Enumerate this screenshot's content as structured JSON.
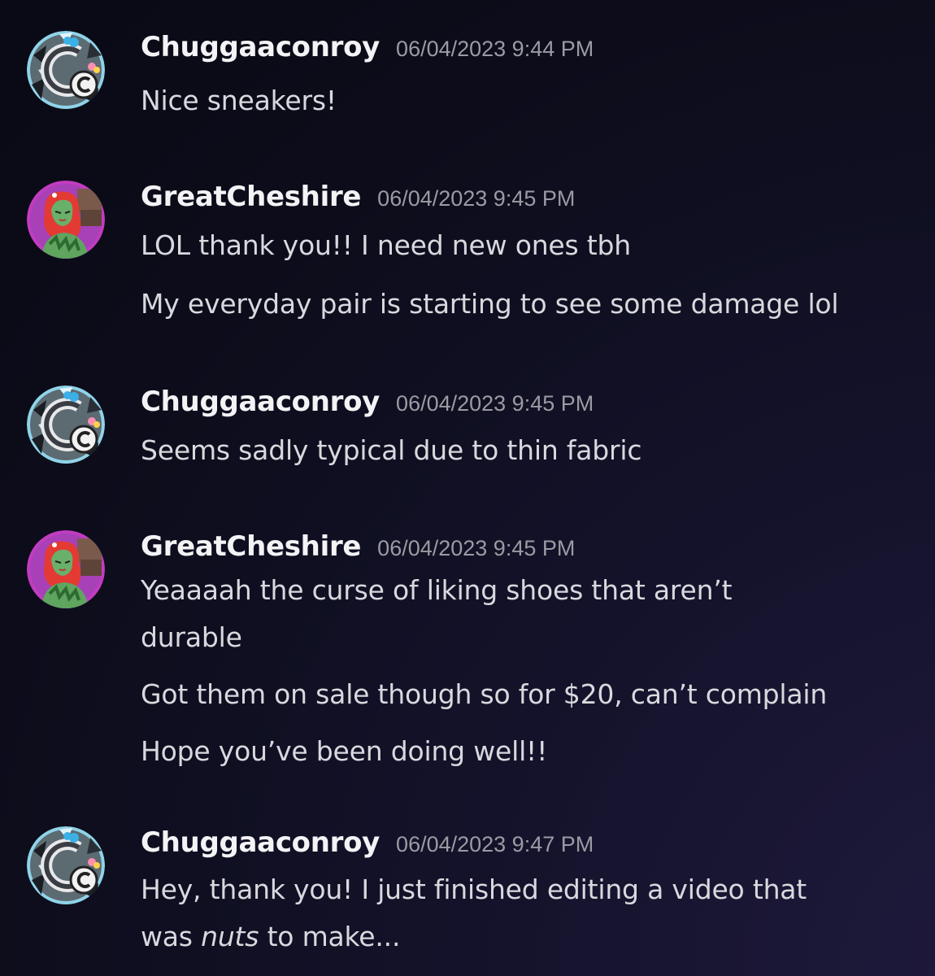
{
  "messages": [
    {
      "author": "Chuggaaconroy",
      "timestamp": "06/04/2023 9:44 PM",
      "avatar": "chuggaaconroy-avatar",
      "lines": [
        "Nice sneakers!"
      ]
    },
    {
      "author": "GreatCheshire",
      "timestamp": "06/04/2023 9:45 PM",
      "avatar": "greatcheshire-avatar",
      "lines": [
        "LOL thank you!! I need new ones tbh",
        "My everyday pair is starting to see some damage lol"
      ]
    },
    {
      "author": "Chuggaaconroy",
      "timestamp": "06/04/2023 9:45 PM",
      "avatar": "chuggaaconroy-avatar",
      "lines": [
        "Seems sadly typical due to thin fabric"
      ]
    },
    {
      "author": "GreatCheshire",
      "timestamp": "06/04/2023 9:45 PM",
      "avatar": "greatcheshire-avatar",
      "lines": [
        "Yeaaaah the curse of liking shoes that aren’t",
        "durable",
        "Got them on sale though so for $20, can’t complain",
        "Hope you’ve been doing well!!"
      ]
    },
    {
      "author": "Chuggaaconroy",
      "timestamp": "06/04/2023 9:47 PM",
      "avatar": "chuggaaconroy-avatar",
      "lines": [
        "Hey, thank you! I just finished editing a video that"
      ],
      "last_line": {
        "before": "was ",
        "emphasis": "nuts",
        "after": " to make..."
      }
    }
  ],
  "colors": {
    "background": "#0c0c1a",
    "username": "#f3f3f6",
    "timestamp": "#9a9ba3",
    "text": "#d8d9de"
  }
}
